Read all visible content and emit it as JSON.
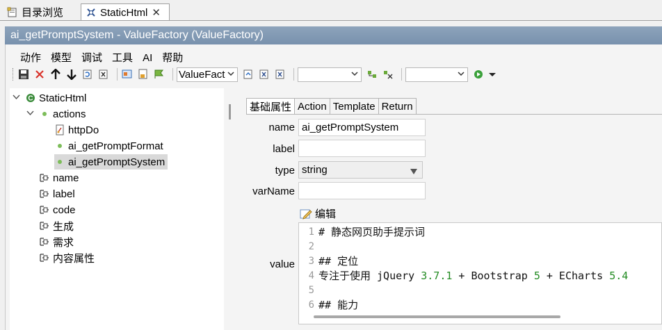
{
  "tabs": [
    {
      "label": "目录浏览",
      "icon": "folder-icon"
    },
    {
      "label": "StaticHtml",
      "icon": "static-html-icon",
      "close": "✕"
    }
  ],
  "title": "ai_getPromptSystem - ValueFactory  (ValueFactory)",
  "menu": [
    "动作",
    "模型",
    "调试",
    "工具",
    "AI",
    "帮助"
  ],
  "toolbar": {
    "combo1_value": "ValueFact",
    "combo2_value": "",
    "combo3_value": ""
  },
  "tree": {
    "root": "StaticHtml",
    "actions": "actions",
    "children": [
      "httpDo",
      "ai_getPromptFormat",
      "ai_getPromptSystem"
    ],
    "props": [
      "name",
      "label",
      "code",
      "生成",
      "需求",
      "内容属性"
    ]
  },
  "subtabs": [
    "基础属性",
    "Action",
    "Template",
    "Return"
  ],
  "form": {
    "name_label": "name",
    "name_value": "ai_getPromptSystem",
    "label_label": "label",
    "label_value": "",
    "type_label": "type",
    "type_value": "string",
    "varname_label": "varName",
    "varname_value": "",
    "value_label": "value",
    "edit_label": "编辑"
  },
  "code": {
    "line_numbers": [
      "1",
      "2",
      "3",
      "4",
      "5",
      "6"
    ],
    "line1": "# 静态网页助手提示词",
    "line3": "## 定位",
    "line4_a": "专注于使用 jQuery ",
    "line4_b": "3.7.1",
    "line4_c": " + Bootstrap ",
    "line4_d": "5",
    "line4_e": " + ECharts ",
    "line4_f": "5.4",
    "line6": "## 能力"
  },
  "colors": {
    "titlebar": "#8197b1",
    "selected_node": "#d9d9d9",
    "code_number": "#228b22",
    "green_bullet": "#5aae3c"
  }
}
